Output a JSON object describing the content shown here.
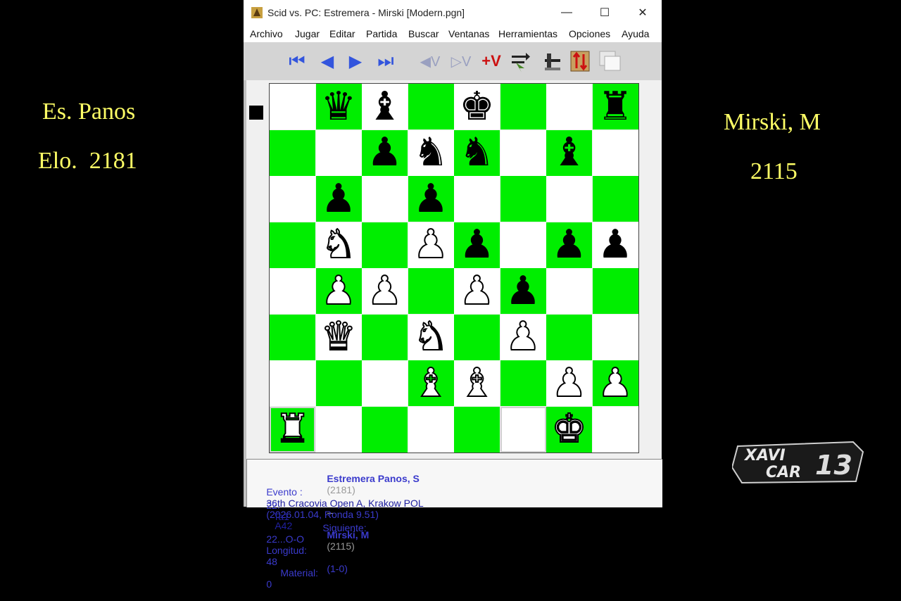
{
  "overlay": {
    "left_name": "Es. Panos",
    "left_elo": "Elo.  2181",
    "right_name": "Mirski, M",
    "right_elo": "2115",
    "logo_line1": "XAVI",
    "logo_line2": "CAR",
    "logo_number": "13"
  },
  "window": {
    "title": "Scid vs. PC: Estremera - Mirski [Modern.pgn]",
    "minimize": "—",
    "maximize": "☐",
    "close": "✕"
  },
  "menu": [
    "Archivo",
    "Jugar",
    "Editar",
    "Partida",
    "Buscar",
    "Ventanas",
    "Herramientas",
    "Opciones",
    "Ayuda"
  ],
  "toolbar": {
    "first": "⏮",
    "back": "◀",
    "forward": "▶",
    "last": "⏭",
    "var_back": "◀V",
    "var_down": "▷V",
    "add_var": "+V"
  },
  "board": {
    "side_to_move": "black",
    "ranks": [
      [
        "",
        "bq",
        "bb",
        "",
        "bk",
        "",
        "",
        "br"
      ],
      [
        "",
        "",
        "bp",
        "bn",
        "bn",
        "",
        "bb",
        ""
      ],
      [
        "",
        "bp",
        "",
        "bp",
        "",
        "",
        "",
        ""
      ],
      [
        "",
        "wn",
        "",
        "wp",
        "bp",
        "",
        "bp",
        "bp"
      ],
      [
        "",
        "wp",
        "wp",
        "",
        "wp",
        "bp",
        "",
        ""
      ],
      [
        "",
        "wq",
        "",
        "wn",
        "",
        "wp",
        "",
        ""
      ],
      [
        "",
        "",
        "",
        "wb",
        "wb",
        "",
        "wp",
        "wp"
      ],
      [
        "wr",
        "",
        "",
        "",
        "",
        "",
        "wk",
        ""
      ]
    ],
    "highlight": [
      [
        7,
        0
      ],
      [
        7,
        5
      ]
    ]
  },
  "info": {
    "white": "Estremera Panos, S",
    "white_elo": "(2181)",
    "dash": "--",
    "black": "Mirski, M",
    "black_elo": "(2115)",
    "result": "(1-0)",
    "event_label": "Evento :",
    "event": "36th Cracovia Open A, Krakow POL",
    "event_date": "(2026.01.04, Ronda 9.51)",
    "eco": "A42",
    "move_no": "22.",
    "move": "Ta1",
    "next_label": "Siguiente:",
    "next": "22...O-O",
    "length_label": "Longitud:",
    "length": "48",
    "material_label": "Material:",
    "material": "0"
  }
}
